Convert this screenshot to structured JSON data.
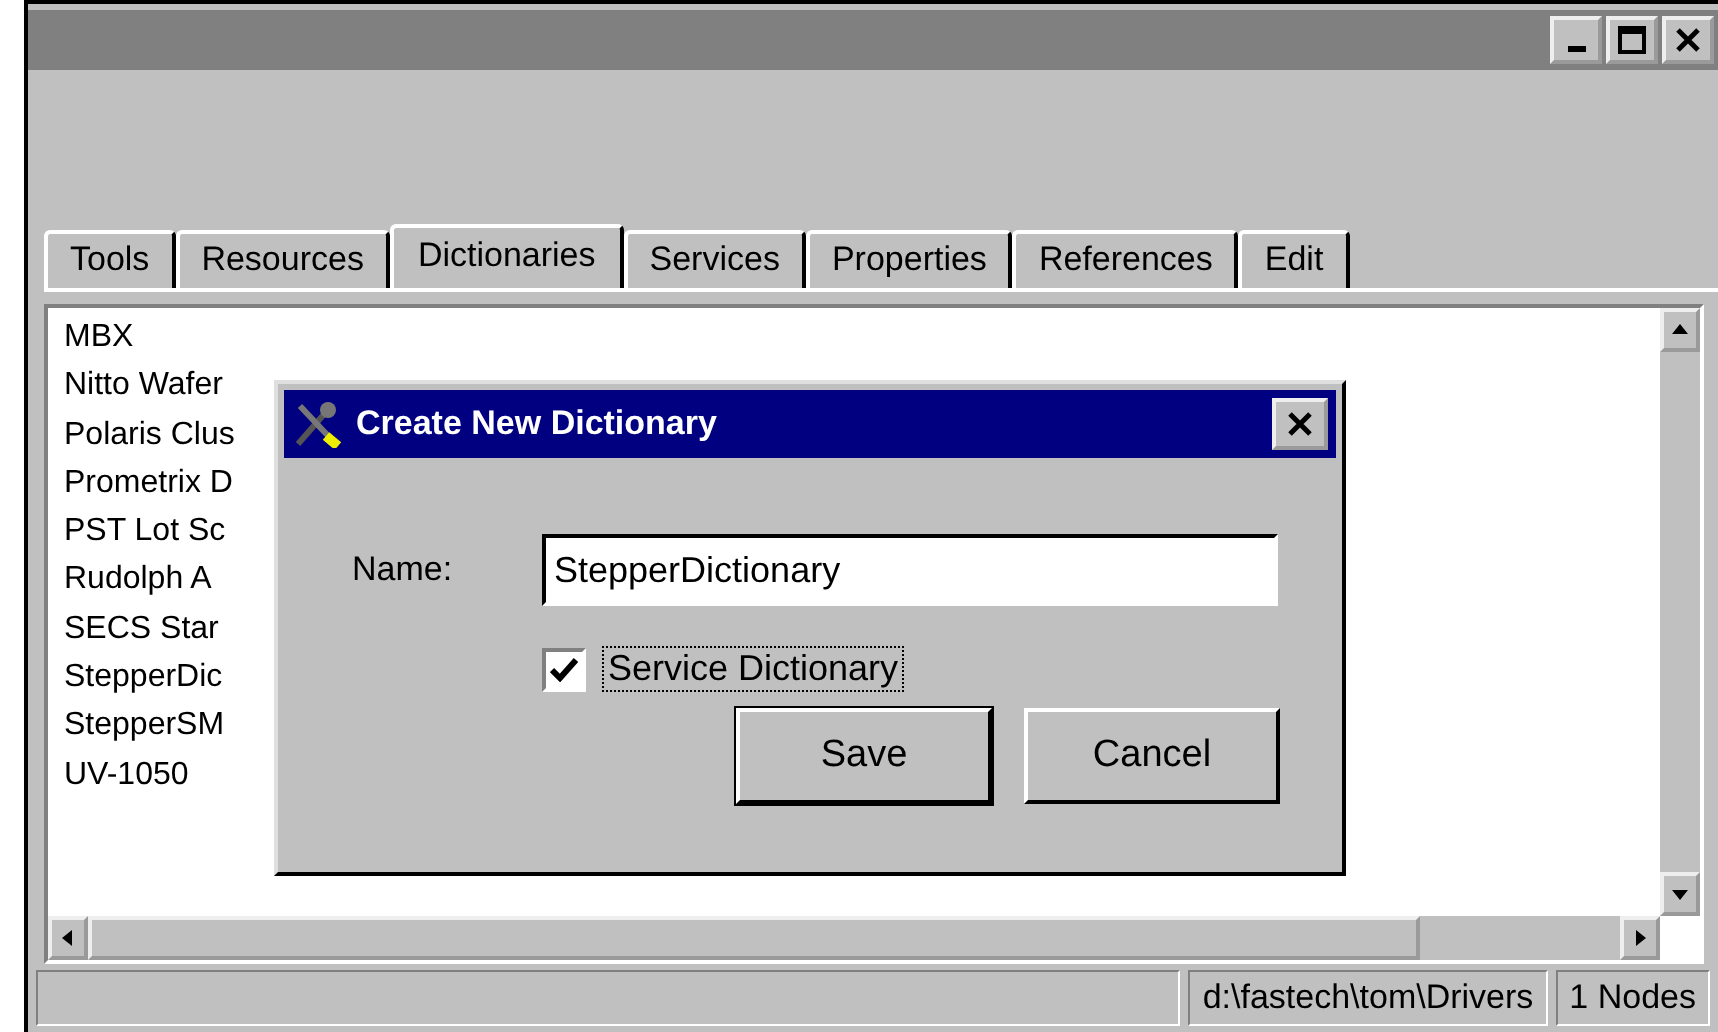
{
  "tabs": [
    {
      "label": "Tools",
      "selected": false
    },
    {
      "label": "Resources",
      "selected": false
    },
    {
      "label": "Dictionaries",
      "selected": true
    },
    {
      "label": "Services",
      "selected": false
    },
    {
      "label": "Properties",
      "selected": false
    },
    {
      "label": "References",
      "selected": false
    },
    {
      "label": "Edit",
      "selected": false
    }
  ],
  "list": {
    "items": [
      "MBX",
      "Nitto Wafer",
      "Polaris Clus",
      "Prometrix D",
      "PST Lot Sc",
      "Rudolph A",
      "SECS Star",
      "StepperDic",
      "StepperSM",
      "UV-1050"
    ]
  },
  "dialog": {
    "title": "Create New Dictionary",
    "name_label": "Name:",
    "name_value": "StepperDictionary",
    "checkbox": {
      "label": "Service Dictionary",
      "checked": true
    },
    "buttons": [
      {
        "label": "Save",
        "default": true
      },
      {
        "label": "Cancel",
        "default": false
      }
    ]
  },
  "status_bar": [
    "d:\\fastech\\tom\\Drivers",
    "1 Nodes"
  ]
}
